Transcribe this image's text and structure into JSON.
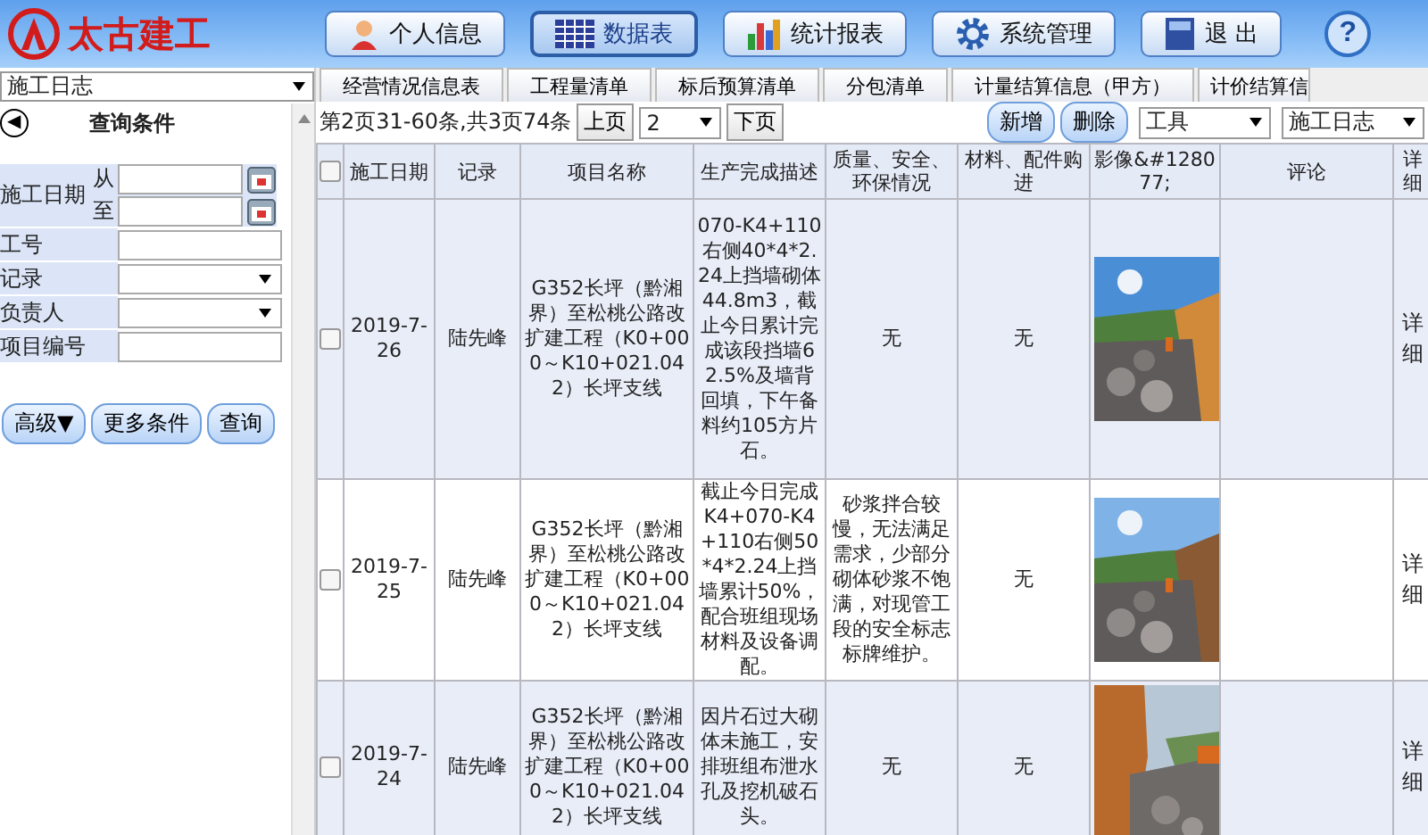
{
  "header": {
    "logo_text": "太古建工",
    "nav": [
      {
        "label": "个人信息",
        "selected": false
      },
      {
        "label": "数据表",
        "selected": true
      },
      {
        "label": "统计报表",
        "selected": false
      },
      {
        "label": "系统管理",
        "selected": false
      },
      {
        "label": "退 出",
        "selected": false
      }
    ],
    "help": "?"
  },
  "sidebar": {
    "module_select": "施工日志",
    "toggle": "◀",
    "title": "查询条件",
    "fields": [
      {
        "label": "施工日期",
        "kind": "daterange",
        "from": "从",
        "to": "至"
      },
      {
        "label": "工号",
        "kind": "text"
      },
      {
        "label": "记录",
        "kind": "select"
      },
      {
        "label": "负责人",
        "kind": "select"
      },
      {
        "label": "项目编号",
        "kind": "text"
      }
    ],
    "buttons": [
      "高级▼",
      "更多条件",
      "查询"
    ]
  },
  "tabs": [
    "经营情况信息表",
    "工程量清单",
    "标后预算清单",
    "分包清单",
    "计量结算信息（甲方）",
    "计价结算信"
  ],
  "toolbar": {
    "page_info": "第2页31-60条,共3页74条",
    "prev": "上页",
    "page_select": "2",
    "next": "下页",
    "buttons": [
      "新增",
      "删除"
    ],
    "selects": [
      "工具",
      "施工日志"
    ]
  },
  "table": {
    "select_all_checked": false,
    "columns": [
      "施工日期",
      "记录",
      "项目名称",
      "生产完成描述",
      "质量、安全、环保情况",
      "材料、配件购进",
      "影像&#128077;",
      "评论",
      "详细"
    ],
    "rows": [
      {
        "checked": false,
        "date": "2019-7-26",
        "record": "陆先峰",
        "project": "G352长坪（黔湘界）至松桃公路改扩建工程（K0+000～K10+021.042）长坪支线",
        "description": "070-K4+110右侧40*4*2.24上挡墙砌体44.8m3，截止今日累计完成该段挡墙62.5%及墙背回填，下午备料约105方片石。",
        "quality": "无",
        "materials": "无",
        "detail": "详细"
      },
      {
        "checked": false,
        "date": "2019-7-25",
        "record": "陆先峰",
        "project": "G352长坪（黔湘界）至松桃公路改扩建工程（K0+000～K10+021.042）长坪支线",
        "description": "截止今日完成K4+070-K4+110右侧50*4*2.24上挡墙累计50%，配合班组现场材料及设备调配。",
        "quality": "砂浆拌合较慢，无法满足需求，少部分砌体砂浆不饱满，对现管工段的安全标志标牌维护。",
        "materials": "无",
        "detail": "详细"
      },
      {
        "checked": false,
        "date": "2019-7-24",
        "record": "陆先峰",
        "project": "G352长坪（黔湘界）至松桃公路改扩建工程（K0+000～K10+021.042）长坪支线",
        "description": "因片石过大砌体未施工，安排班组布泄水孔及挖机破石头。",
        "quality": "无",
        "materials": "无",
        "detail": "详细"
      }
    ]
  }
}
